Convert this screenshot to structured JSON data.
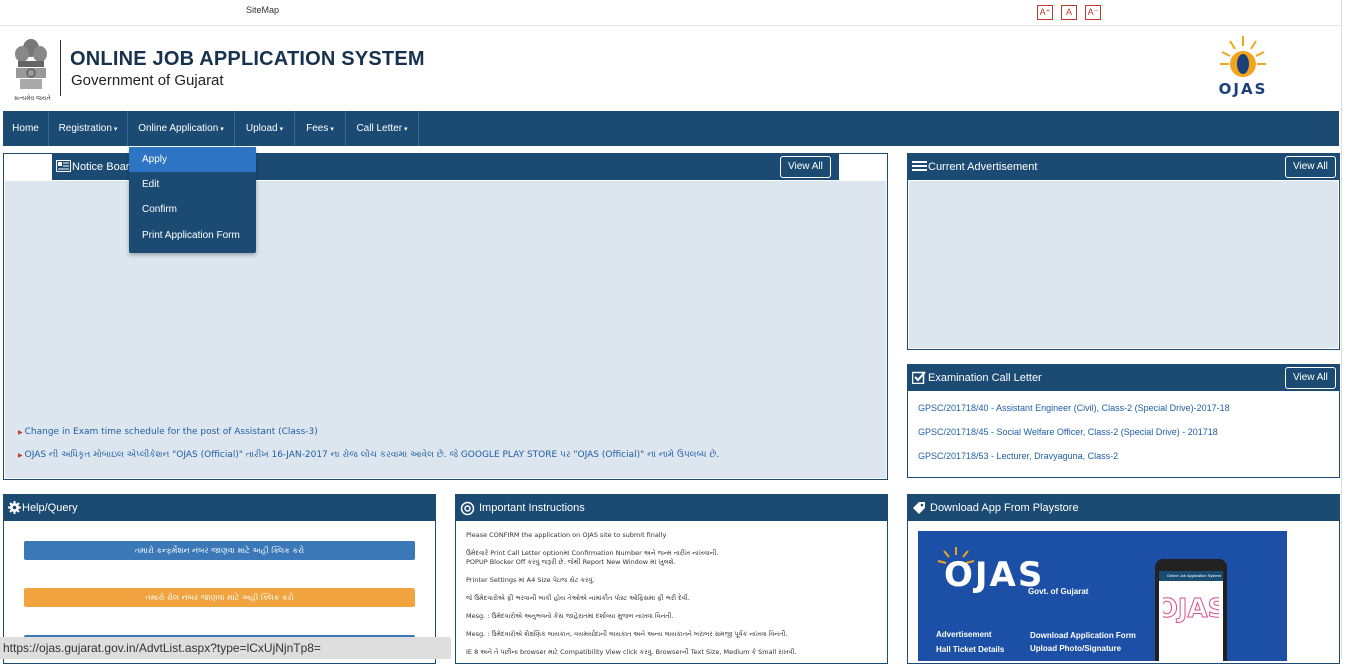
{
  "topbar": {
    "sitemap": "SiteMap",
    "font_controls": [
      "A⁺",
      "A",
      "A⁻"
    ]
  },
  "header": {
    "title": "ONLINE JOB APPLICATION SYSTEM",
    "subtitle": "Government of Gujarat",
    "emblem_caption": "સત્યમેવ જયતે",
    "logo_text": "OJAS"
  },
  "nav": {
    "items": [
      {
        "label": "Home",
        "caret": ""
      },
      {
        "label": "Registration",
        "caret": "▾"
      },
      {
        "label": "Online Application",
        "caret": "▾"
      },
      {
        "label": "Upload",
        "caret": "▾"
      },
      {
        "label": "Fees",
        "caret": "▾"
      },
      {
        "label": "Call Letter",
        "caret": "▾"
      }
    ],
    "dropdown": [
      "Apply",
      "Edit",
      "Confirm",
      "Print Application Form"
    ]
  },
  "notice": {
    "title": "Notice Boar",
    "view_all": "View All",
    "items": [
      "Change in Exam time schedule for the post of Assistant (Class-3)",
      "OJAS ની અધિકૃત મોબાઇલ એપ્લીકેશન \"OJAS (Official)\" તારીખ 16-JAN-2017 ના રોજ લોંચ કરવામાં આવેલ છે. જે GOOGLE PLAY STORE પર \"OJAS (Official)\" નાં નામે ઉપલબ્ધ છે."
    ]
  },
  "advertisement": {
    "title": "Current Advertisement",
    "view_all": "View All"
  },
  "call_letter": {
    "title": "Examination Call Letter",
    "view_all": "View All",
    "items": [
      "GPSC/201718/40 - Assistant Engineer (Civil), Class-2 (Special Drive)-2017-18",
      "GPSC/201718/45 - Social Welfare Officer, Class-2 (Special Drive) - 201718",
      "GPSC/201718/53 - Lecturer, Dravyaguna, Class-2"
    ]
  },
  "help": {
    "title": "Help/Query",
    "buttons": [
      {
        "label": "તમારો કન્ફર્મેશન નંબર જાણવા માટે અહી ક્લિક કરો",
        "color": "#3a78b8"
      },
      {
        "label": "તમારો રોલ નંબર જાણવા માટે અહી ક્લિક કરો",
        "color": "#f0a33f"
      }
    ]
  },
  "instructions": {
    "title": "Important Instructions",
    "lines": [
      "Please CONFIRM the application on OJAS site to submit finally",
      "ઉમેદવારે Print Call Letter optionમાં Confirmation Number અને જન્મ તારીખ નાખવાની.",
      "POPUP Blocker Off કરવું જરૂરી છે. જેથી Report New Window માં ખુલશે.",
      "Printer Settings માં A4 Size પેઇજ સેટ કરવું.",
      "જે ઉમેદવારોએ ફી ભરવાની બાકી હોય તેઓએ નામાંકીત પોસ્ટ ઓફિસમાં ફી ભરી દેવી.",
      "Mesg. : ઉમેદવારોએ અનુભવનો કેસ જાહેરાતમાં દર્શાવ્યા મુજબ નાખવા વિનંતી.",
      "Mesg. : ઉમેદવારોએ શૈક્ષણિક લાયકાત, વયમર્યાદાની લાયકાત અને અન્ય લાયકાતને બરાબર સમજી પૂર્વક નાખવા વિનંતી.",
      "IE 8 અને તે પછીના browser માટે Compatibility View click કરવું. Browserની Text Size, Medium કે Small રાખવી."
    ]
  },
  "download_app": {
    "title": "Download App From Playstore",
    "banner_title": "OJAS",
    "banner_sub": "Govt. of Gujarat",
    "features_left": [
      "Advertisement",
      "Hall Ticket Details"
    ],
    "features_right": [
      "Download Application Form",
      "Upload Photo/Signature"
    ],
    "phone_bar": "Online Job Application System"
  },
  "status_url": "https://ojas.gujarat.gov.in/AdvtList.aspx?type=lCxUjNjnTp8=",
  "colors": {
    "navy": "#1b4b73",
    "dropdown_active": "#2d74c4",
    "link": "#1f5fa3",
    "help_blue": "#3a78b8",
    "help_orange": "#f0a33f"
  }
}
